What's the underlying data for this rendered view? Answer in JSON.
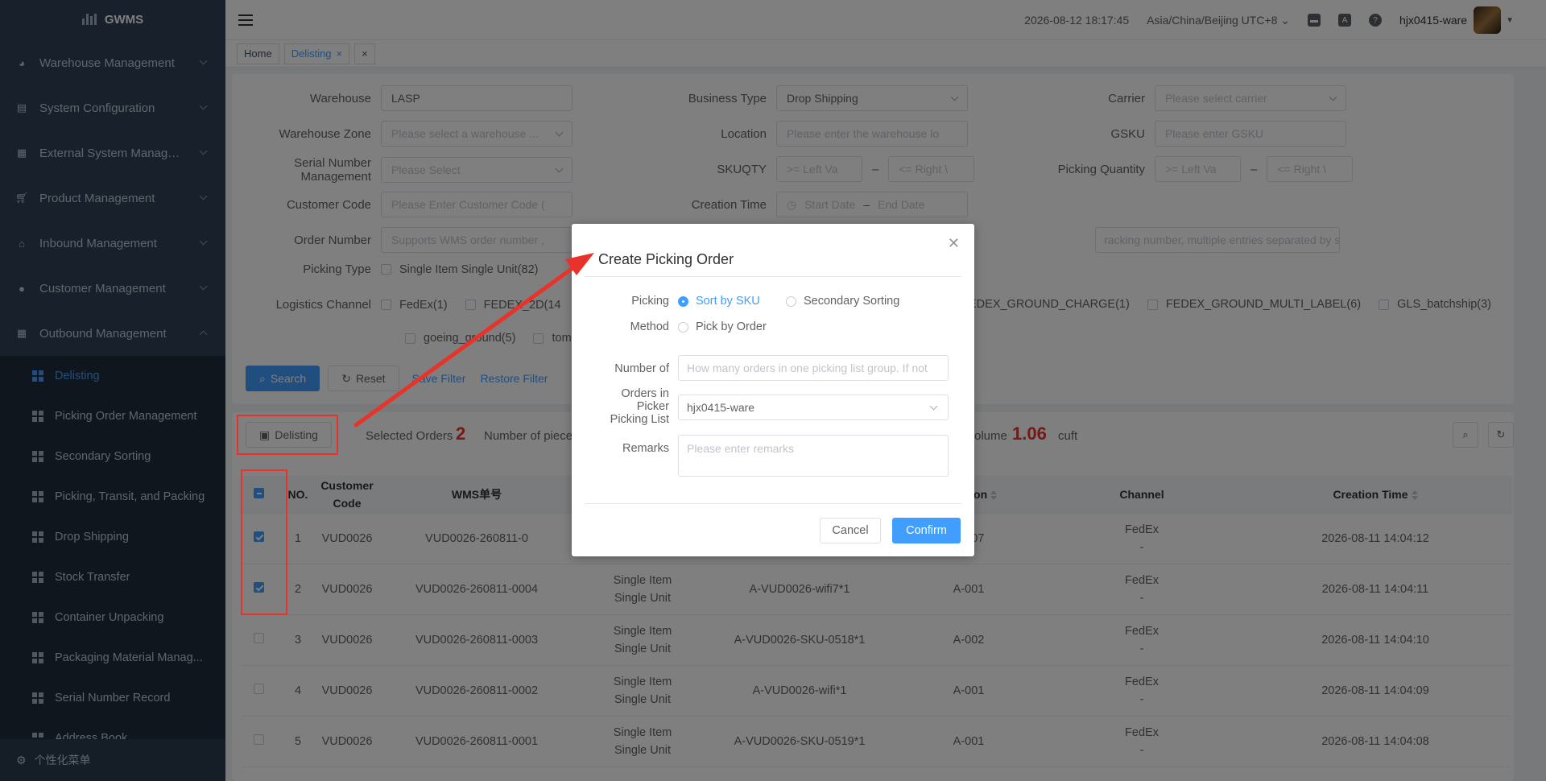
{
  "app": {
    "name": "GWMS"
  },
  "sidebar": {
    "menus": [
      {
        "label": "Warehouse Management",
        "icon": "pie-chart-icon"
      },
      {
        "label": "System Configuration",
        "icon": "monitor-icon"
      },
      {
        "label": "External System Manage...",
        "icon": "grid-icon"
      },
      {
        "label": "Product Management",
        "icon": "cart-icon"
      },
      {
        "label": "Inbound Management",
        "icon": "home-icon"
      },
      {
        "label": "Customer Management",
        "icon": "user-icon"
      },
      {
        "label": "Outbound Management",
        "icon": "grid-icon"
      }
    ],
    "submenu": [
      {
        "label": "Delisting",
        "active": true
      },
      {
        "label": "Picking Order Management"
      },
      {
        "label": "Secondary Sorting"
      },
      {
        "label": "Picking, Transit, and Packing"
      },
      {
        "label": "Drop Shipping"
      },
      {
        "label": "Stock Transfer"
      },
      {
        "label": "Container Unpacking"
      },
      {
        "label": "Packaging Material Manag..."
      },
      {
        "label": "Serial Number Record"
      },
      {
        "label": "Address Book"
      }
    ],
    "personal": "个性化菜单"
  },
  "header": {
    "datetime": "2026-08-12 18:17:45",
    "timezone": "Asia/China/Beijing UTC+8",
    "username": "hjx0415-ware"
  },
  "tags": {
    "home": "Home",
    "current": "Delisting"
  },
  "filters": {
    "warehouse": {
      "label": "Warehouse",
      "value": "LASP"
    },
    "business_type": {
      "label": "Business Type",
      "value": "Drop Shipping"
    },
    "carrier": {
      "label": "Carrier",
      "placeholder": "Please select carrier"
    },
    "warehouse_zone": {
      "label": "Warehouse Zone",
      "placeholder": "Please select a warehouse ..."
    },
    "location": {
      "label": "Location",
      "placeholder": "Please enter the warehouse lo"
    },
    "gsku": {
      "label": "GSKU",
      "placeholder": "Please enter GSKU"
    },
    "serial_number": {
      "label": "Serial Number Management",
      "placeholder": "Please Select"
    },
    "skuqty": {
      "label": "SKUQTY",
      "left": ">= Left Va",
      "right": "<= Right \\"
    },
    "picking_quantity": {
      "label": "Picking Quantity",
      "left": ">= Left Va",
      "right": "<= Right \\"
    },
    "customer_code": {
      "label": "Customer Code",
      "placeholder": "Please Enter Customer Code ("
    },
    "creation_time": {
      "label": "Creation Time",
      "start": "Start Date",
      "end": "End Date"
    },
    "order_number": {
      "label": "Order Number",
      "placeholder": "Supports WMS order number ,",
      "tracking_placeholder": "racking number, multiple entries separated by spaces or commas"
    },
    "picking_type": {
      "label": "Picking Type",
      "option": "Single Item Single Unit(82)"
    },
    "logistics_channel": {
      "label": "Logistics Channel",
      "options_row1": [
        "FedEx(1)",
        "FEDEX_2D(14",
        "EDEX_GROUND_CHARGE(1)",
        "FEDEX_GROUND_MULTI_LABEL(6)",
        "GLS_batchship(3)"
      ],
      "options_row2": [
        "goeing_ground(5)",
        "tom"
      ]
    },
    "search_btn": "Search",
    "reset_btn": "Reset",
    "save_filter": "Save Filter",
    "restore_filter": "Restore Filter"
  },
  "toolbar": {
    "delisting_btn": "Delisting",
    "selected_label": "Selected Orders",
    "selected_count": "2",
    "pieces_label": "Number of piece",
    "volume_label": "olume",
    "volume_value": "1.06",
    "volume_unit": "cuft"
  },
  "table": {
    "headers": {
      "no": "NO.",
      "customer_code": "Customer Code",
      "wms": "WMS单号",
      "location": "Location",
      "channel": "Channel",
      "creation_time": "Creation Time"
    },
    "rows": [
      {
        "checked": true,
        "no": "1",
        "customer": "VUD0026",
        "wms": "VUD0026-260811-0",
        "type1": "",
        "type2": "",
        "sku": "",
        "location": "A-007",
        "channel": "FedEx",
        "channel2": "-",
        "time": "2026-08-11 14:04:12"
      },
      {
        "checked": true,
        "no": "2",
        "customer": "VUD0026",
        "wms": "VUD0026-260811-0004",
        "type1": "Single Item",
        "type2": "Single Unit",
        "sku": "A-VUD0026-wifi7*1",
        "location": "A-001",
        "channel": "FedEx",
        "channel2": "-",
        "time": "2026-08-11 14:04:11"
      },
      {
        "checked": false,
        "no": "3",
        "customer": "VUD0026",
        "wms": "VUD0026-260811-0003",
        "type1": "Single Item",
        "type2": "Single Unit",
        "sku": "A-VUD0026-SKU-0518*1",
        "location": "A-002",
        "channel": "FedEx",
        "channel2": "-",
        "time": "2026-08-11 14:04:10"
      },
      {
        "checked": false,
        "no": "4",
        "customer": "VUD0026",
        "wms": "VUD0026-260811-0002",
        "type1": "Single Item",
        "type2": "Single Unit",
        "sku": "A-VUD0026-wifi*1",
        "location": "A-001",
        "channel": "FedEx",
        "channel2": "-",
        "time": "2026-08-11 14:04:09"
      },
      {
        "checked": false,
        "no": "5",
        "customer": "VUD0026",
        "wms": "VUD0026-260811-0001",
        "type1": "Single Item",
        "type2": "Single Unit",
        "sku": "A-VUD0026-SKU-0519*1",
        "location": "A-001",
        "channel": "FedEx",
        "channel2": "-",
        "time": "2026-08-11 14:04:08"
      }
    ]
  },
  "dialog": {
    "title": "Create Picking Order",
    "picking_method_label_1": "Picking",
    "picking_method_label_2": "Method",
    "opt_sort_by_sku": "Sort by SKU",
    "opt_secondary_sorting": "Secondary Sorting",
    "opt_pick_by_order": "Pick by Order",
    "number_of_label": "Number of",
    "number_of_placeholder": "How many orders in one picking list group. If not",
    "orders_label_1": "Orders in",
    "orders_label_2": "Picker",
    "orders_label_3": "Picking List",
    "picker_value": "hjx0415-ware",
    "remarks_label": "Remarks",
    "remarks_placeholder": "Please enter remarks",
    "cancel": "Cancel",
    "confirm": "Confirm"
  },
  "colors": {
    "accent": "#409eff",
    "annotation": "#e8322a",
    "sidebar": "#304156"
  }
}
